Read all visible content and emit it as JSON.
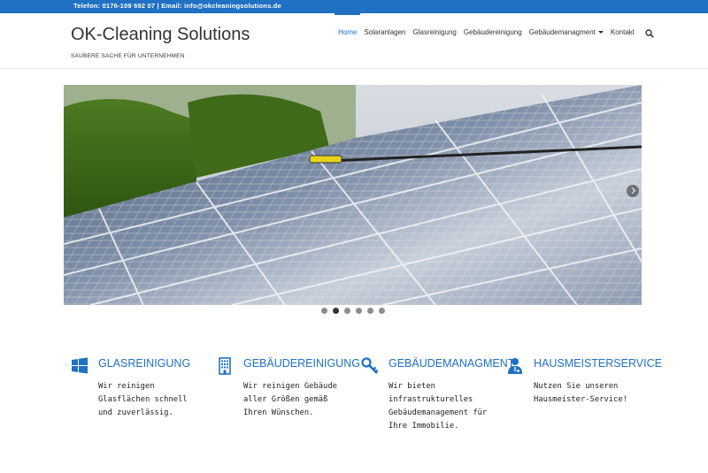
{
  "topbar": {
    "contact": "Telefon:  0176-109  692  07  |  Email:  info@okcleaningsolutions.de"
  },
  "header": {
    "brand": "OK-Cleaning Solutions",
    "tagline": "SAUBERE SACHE FÜR UNTERNEHMEN"
  },
  "nav": {
    "items": [
      {
        "label": "Home"
      },
      {
        "label": "Solaranlagen"
      },
      {
        "label": "Glasreinigung"
      },
      {
        "label": "Gebäudereinigung"
      },
      {
        "label": "Gebäudemanagment"
      },
      {
        "label": "Kontakt"
      }
    ],
    "search_icon": "search-icon"
  },
  "slider": {
    "slide_count": 6,
    "active_index": 1
  },
  "services": [
    {
      "icon": "windows-icon",
      "title": "GLASREINIGUNG",
      "text": "Wir reinigen Glasflächen schnell und zuverlässig."
    },
    {
      "icon": "building-icon",
      "title": "GEBÄUDEREINIGUNG",
      "text": "Wir reinigen Gebäude aller Größen gemäß Ihren Wünschen."
    },
    {
      "icon": "key-icon",
      "title": "GEBÄUDEMANAGMENT",
      "text": "Wir bieten infrastrukturelles Gebäudemanagement für Ihre Immobilie."
    },
    {
      "icon": "user-md-icon",
      "title": "HAUSMEISTERSERVICE",
      "text": "Nutzen Sie unseren Hausmeister-Service!"
    }
  ],
  "colors": {
    "accent": "#2070c4",
    "text": "#333333"
  }
}
